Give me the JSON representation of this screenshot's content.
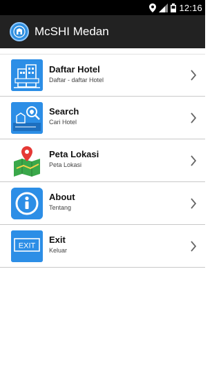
{
  "status_bar": {
    "time": "12:16",
    "icons": [
      "location-icon",
      "signal-icon",
      "battery-icon"
    ]
  },
  "action_bar": {
    "title": "McSHI Medan",
    "logo_icon": "hotel-logo-icon"
  },
  "menu": {
    "items": [
      {
        "title": "Daftar Hotel",
        "subtitle": "Daftar - daftar Hotel",
        "icon": "hotel-building-icon"
      },
      {
        "title": "Search",
        "subtitle": "Cari Hotel",
        "icon": "search-map-icon"
      },
      {
        "title": "Peta Lokasi",
        "subtitle": "Peta Lokasi",
        "icon": "map-pin-icon"
      },
      {
        "title": "About",
        "subtitle": "Tentang",
        "icon": "info-icon"
      },
      {
        "title": "Exit",
        "subtitle": "Keluar",
        "icon": "exit-sign-icon"
      }
    ]
  },
  "colors": {
    "status_bar": "#000000",
    "action_bar": "#222222",
    "icon_tile": "#2c8ee6",
    "divider": "#c8c8c8"
  }
}
